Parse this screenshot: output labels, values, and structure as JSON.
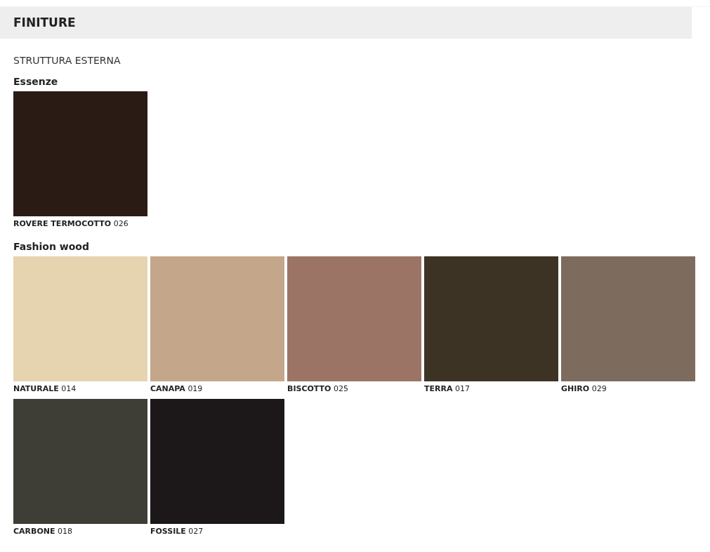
{
  "header": {
    "title": "FINITURE"
  },
  "section": {
    "title": "STRUTTURA ESTERNA"
  },
  "groups": [
    {
      "title": "Essenze",
      "swatches": [
        {
          "name": "ROVERE TERMOCOTTO",
          "code": "026",
          "color": "#2a1c15"
        }
      ]
    },
    {
      "title": "Fashion wood",
      "swatches": [
        {
          "name": "NATURALE",
          "code": "014",
          "color": "#e6d3b0"
        },
        {
          "name": "CANAPA",
          "code": "019",
          "color": "#c4a68a"
        },
        {
          "name": "BISCOTTO",
          "code": "025",
          "color": "#9c7466"
        },
        {
          "name": "TERRA",
          "code": "017",
          "color": "#3d3325"
        },
        {
          "name": "GHIRO",
          "code": "029",
          "color": "#7d6b5e"
        },
        {
          "name": "CARBONE",
          "code": "018",
          "color": "#3e3e36"
        },
        {
          "name": "FOSSILE",
          "code": "027",
          "color": "#1c1719"
        }
      ]
    }
  ]
}
